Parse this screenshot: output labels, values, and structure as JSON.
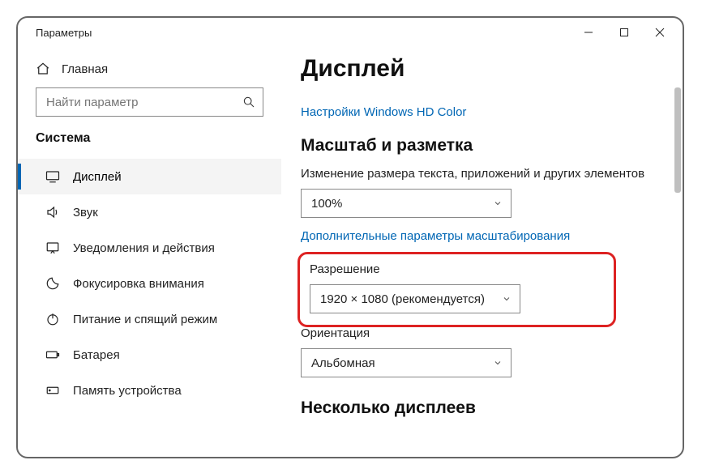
{
  "window_title": "Параметры",
  "sidebar": {
    "home_label": "Главная",
    "search_placeholder": "Найти параметр",
    "section_label": "Система",
    "items": [
      {
        "label": "Дисплей"
      },
      {
        "label": "Звук"
      },
      {
        "label": "Уведомления и действия"
      },
      {
        "label": "Фокусировка внимания"
      },
      {
        "label": "Питание и спящий режим"
      },
      {
        "label": "Батарея"
      },
      {
        "label": "Память устройства"
      }
    ]
  },
  "main": {
    "page_title": "Дисплей",
    "hd_color_link": "Настройки Windows HD Color",
    "scale_heading": "Масштаб и разметка",
    "scale_label": "Изменение размера текста, приложений и других элементов",
    "scale_value": "100%",
    "advanced_scale_link": "Дополнительные параметры масштабирования",
    "resolution_label": "Разрешение",
    "resolution_value": "1920 × 1080 (рекомендуется)",
    "orientation_label": "Ориентация",
    "orientation_value": "Альбомная",
    "multi_display_heading": "Несколько дисплеев"
  }
}
